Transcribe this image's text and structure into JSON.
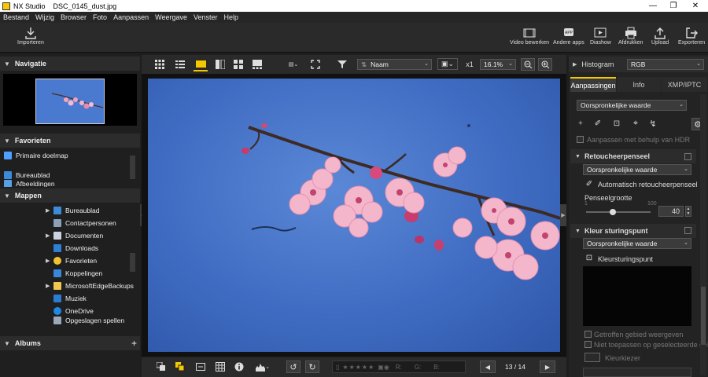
{
  "window": {
    "app_name": "NX Studio",
    "file_name": "DSC_0145_dust.jpg"
  },
  "menu": [
    "Bestand",
    "Wijzig",
    "Browser",
    "Foto",
    "Aanpassen",
    "Weergave",
    "Venster",
    "Help"
  ],
  "toolbar": {
    "import_label": "Importeren",
    "right_tools": [
      "Video bewerken",
      "Andere apps",
      "Diashow",
      "Afdrukken",
      "Upload",
      "Exporteren"
    ]
  },
  "left": {
    "navigation_title": "Navigatie",
    "favorites_title": "Favorieten",
    "favorites_items": [
      "Primaire doelmap",
      "Bureaublad",
      "Afbeeldingen"
    ],
    "folders_title": "Mappen",
    "folders": [
      "Bureaublad",
      "Contactpersonen",
      "Documenten",
      "Downloads",
      "Favorieten",
      "Koppelingen",
      "MicrosoftEdgeBackups",
      "Muziek",
      "OneDrive",
      "Opgeslagen spellen"
    ],
    "albums_title": "Albums",
    "albums_add": "+"
  },
  "center": {
    "sort_label": "Naam",
    "zoom_multiplier": "x1",
    "zoom_percent": "16.1%",
    "bottom": {
      "rating_r": "R:",
      "rating_g": "G:",
      "rating_b": "B:",
      "page_indicator": "13 / 14"
    }
  },
  "right": {
    "histogram_label": "Histogram",
    "histogram_channel": "RGB",
    "tabs": [
      "Aanpassingen",
      "Info",
      "XMP/IPTC"
    ],
    "preset_value": "Oorspronkelijke waarde",
    "hdr_label": "Aanpassen met behulp van HDR",
    "retouch": {
      "title": "Retoucheerpenseel",
      "preset": "Oorspronkelijke waarde",
      "auto_label": "Automatisch retoucheerpenseel",
      "brush_size_label": "Penseelgrootte",
      "min": "1",
      "max": "100",
      "value": "40"
    },
    "color_point": {
      "title": "Kleur sturingspunt",
      "preset": "Oorspronkelijke waarde",
      "point_label": "Kleursturingspunt",
      "show_affected": "Getroffen gebied weergeven",
      "not_apply": "Niet toepassen op geselecteerde gebi",
      "picker_label": "Kleurkiezer"
    }
  },
  "colors": {
    "accent": "#f5c800",
    "sky": "#4a78cc"
  }
}
